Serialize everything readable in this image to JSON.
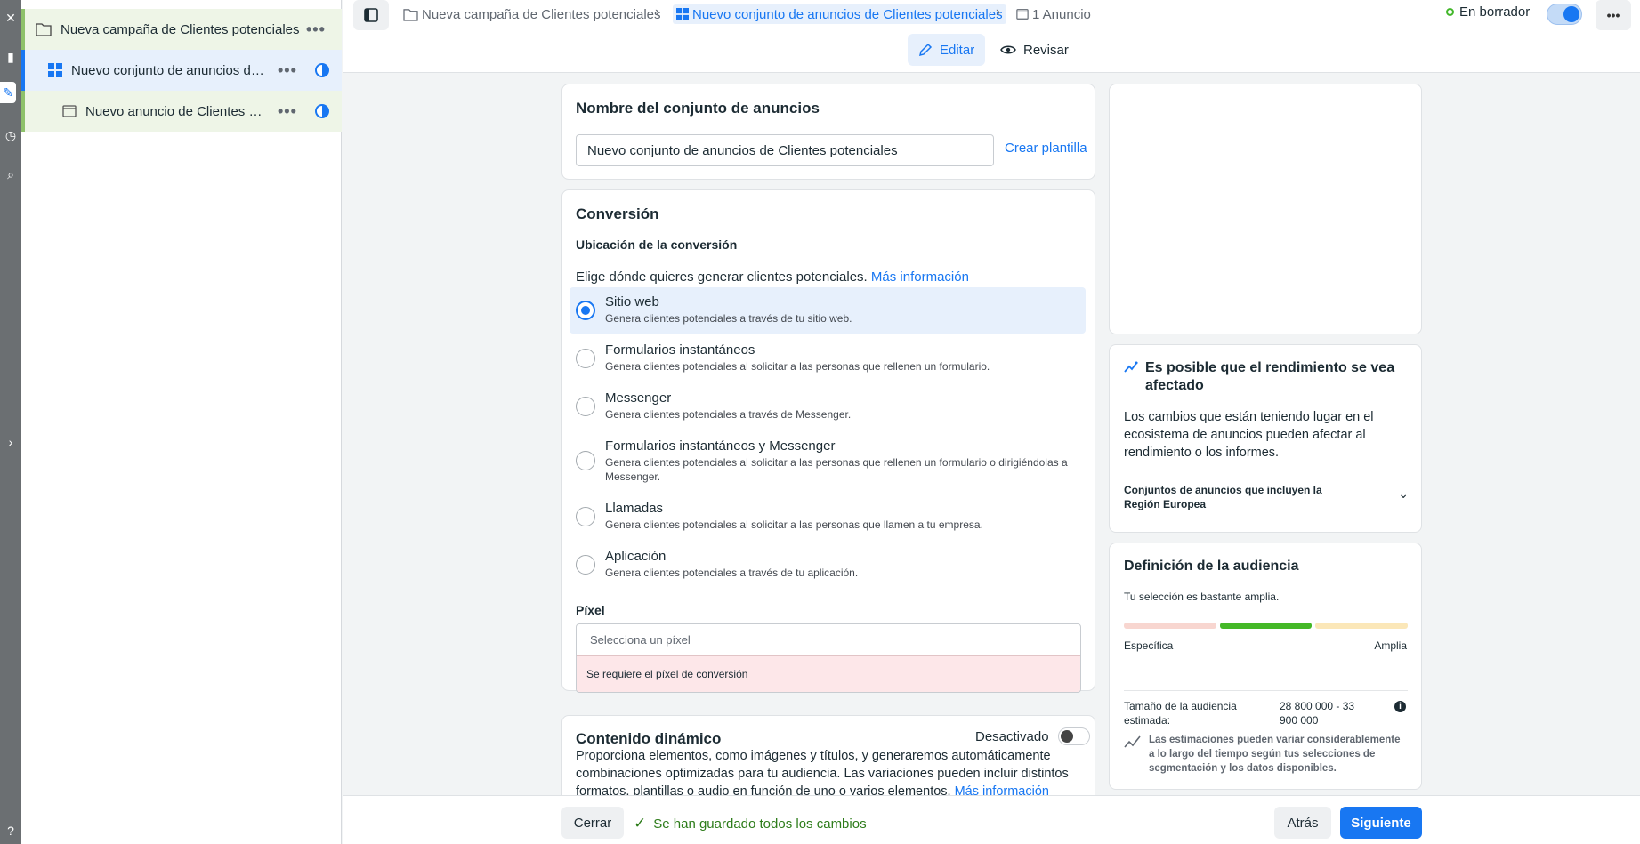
{
  "tree": {
    "campaign": "Nueva campaña de Clientes potenciales",
    "adset": "Nuevo conjunto de anuncios de ...",
    "ad": "Nuevo anuncio de Clientes po...",
    "more": "•••"
  },
  "breadcrumb": {
    "campaign": "Nueva campaña de Clientes potenciales",
    "adset": "Nuevo conjunto de anuncios de Clientes potenciales",
    "ads": "1 Anuncio"
  },
  "status": "En borrador",
  "modes": {
    "edit": "Editar",
    "review": "Revisar"
  },
  "adset_name": {
    "title": "Nombre del conjunto de anuncios",
    "value": "Nuevo conjunto de anuncios de Clientes potenciales",
    "template_link": "Crear plantilla"
  },
  "conversion": {
    "title": "Conversión",
    "location_label": "Ubicación de la conversión",
    "intro": "Elige dónde quieres generar clientes potenciales.",
    "more_info": "Más información",
    "options": [
      {
        "title": "Sitio web",
        "desc": "Genera clientes potenciales a través de tu sitio web."
      },
      {
        "title": "Formularios instantáneos",
        "desc": "Genera clientes potenciales al solicitar a las personas que rellenen un formulario."
      },
      {
        "title": "Messenger",
        "desc": "Genera clientes potenciales a través de Messenger."
      },
      {
        "title": "Formularios instantáneos y Messenger",
        "desc": "Genera clientes potenciales al solicitar a las personas que rellenen un formulario o dirigiéndolas a Messenger."
      },
      {
        "title": "Llamadas",
        "desc": "Genera clientes potenciales al solicitar a las personas que llamen a tu empresa."
      },
      {
        "title": "Aplicación",
        "desc": "Genera clientes potenciales a través de tu aplicación."
      }
    ],
    "selected": "Sitio web",
    "pixel_label": "Píxel",
    "pixel_placeholder": "Selecciona un píxel",
    "pixel_error": "Se requiere el píxel de conversión"
  },
  "dynamic": {
    "title": "Contenido dinámico",
    "toggle_label": "Desactivado",
    "body": "Proporciona elementos, como imágenes y títulos, y generaremos automáticamente combinaciones optimizadas para tu audiencia. Las variaciones pueden incluir distintos formatos, plantillas o audio en función de uno o varios elementos.",
    "more_info": "Más información"
  },
  "performance": {
    "title": "Es posible que el rendimiento se vea afectado",
    "body": "Los cambios que están teniendo lugar en el ecosistema de anuncios pueden afectar al rendimiento o los informes.",
    "expander": "Conjuntos de anuncios que incluyen la Región Europea"
  },
  "audience": {
    "title": "Definición de la audiencia",
    "summary": "Tu selección es bastante amplia.",
    "min_label": "Específica",
    "max_label": "Amplia",
    "selected_segment": 2,
    "segments": 3,
    "size_label": "Tamaño de la audiencia estimada:",
    "size_value": "28 800 000 - 33 900 000",
    "disclaimer": "Las estimaciones pueden variar considerablemente a lo largo del tiempo según tus selecciones de segmentación y los datos disponibles."
  },
  "footer": {
    "close": "Cerrar",
    "saved": "Se han guardado todos los cambios",
    "back": "Atrás",
    "next": "Siguiente"
  },
  "colors": {
    "accent": "#1877f2",
    "success": "#42b72a",
    "error_bg": "#fde7e9"
  }
}
